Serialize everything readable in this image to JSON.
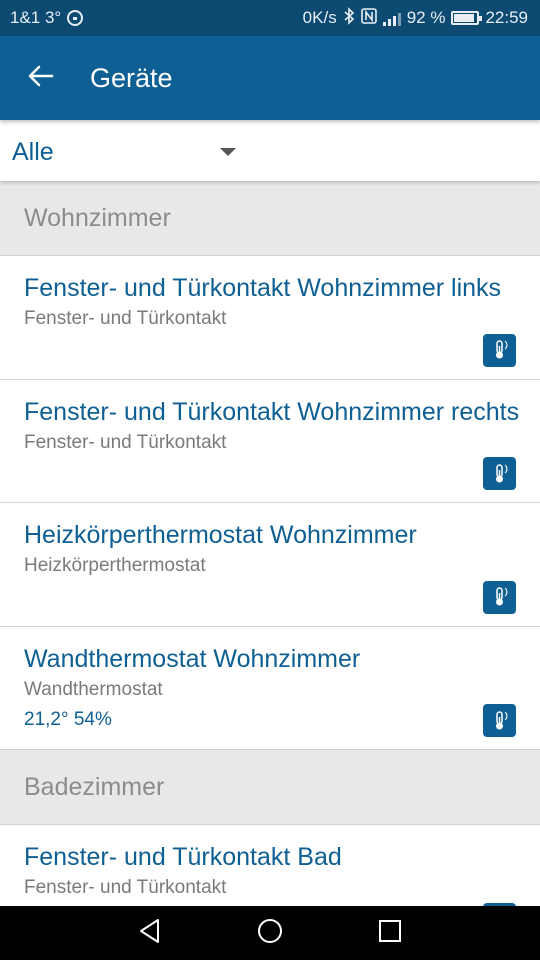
{
  "status_bar": {
    "carrier": "1&1 3°",
    "net_speed": "0K/s",
    "battery_text": "92 %",
    "battery_level": 0.92,
    "time": "22:59"
  },
  "app_bar": {
    "title": "Geräte",
    "back_icon": "arrow-left-icon"
  },
  "filter": {
    "selected": "Alle"
  },
  "sections": [
    {
      "name": "Wohnzimmer"
    },
    {
      "name": "Badezimmer"
    }
  ],
  "devices": [
    {
      "title": "Fenster- und Türkontakt Wohnzimmer links",
      "type": "Fenster- und Türkontakt",
      "reading": ""
    },
    {
      "title": "Fenster- und Türkontakt Wohnzimmer rechts",
      "type": "Fenster- und Türkontakt",
      "reading": ""
    },
    {
      "title": "Heizkörperthermostat Wohnzimmer",
      "type": "Heizkörperthermostat",
      "reading": ""
    },
    {
      "title": "Wandthermostat Wohnzimmer",
      "type": "Wandthermostat",
      "reading": "21,2° 54%"
    },
    {
      "title": "Fenster- und Türkontakt Bad",
      "type": "Fenster- und Türkontakt",
      "reading": ""
    }
  ],
  "colors": {
    "primary": "#0e5f93",
    "status_bar": "#0d4a72",
    "section_bg": "#e7e8ea"
  }
}
